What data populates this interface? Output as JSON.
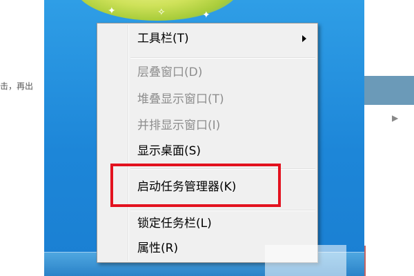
{
  "page": {
    "left_snippet": "击，再出"
  },
  "context_menu": {
    "items": [
      {
        "label": "工具栏(T)",
        "enabled": true,
        "has_submenu": true
      },
      {
        "label": "层叠窗口(D)",
        "enabled": false
      },
      {
        "label": "堆叠显示窗口(T)",
        "enabled": false
      },
      {
        "label": "并排显示窗口(I)",
        "enabled": false
      },
      {
        "label": "显示桌面(S)",
        "enabled": true
      },
      {
        "label": "启动任务管理器(K)",
        "enabled": true,
        "highlighted": true
      },
      {
        "label": "锁定任务栏(L)",
        "enabled": true
      },
      {
        "label": "属性(R)",
        "enabled": true
      }
    ]
  },
  "colors": {
    "highlight_border": "#e3121f",
    "menu_background": "#f0f0f0",
    "desktop_blue": "#1d86d8"
  }
}
